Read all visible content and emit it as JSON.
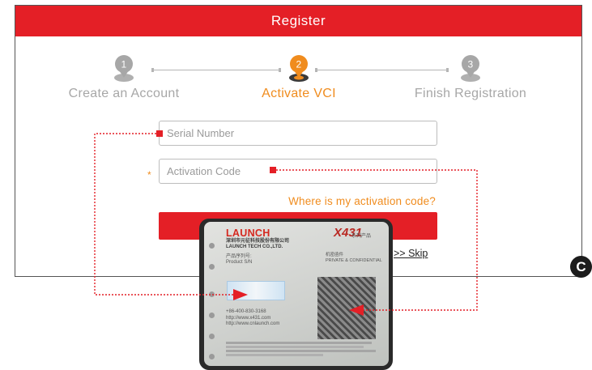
{
  "window": {
    "title": "Register"
  },
  "steps": [
    {
      "number": "1",
      "label": "Create an Account",
      "state": "done",
      "color": "#a7a7a7"
    },
    {
      "number": "2",
      "label": "Activate VCI",
      "state": "active",
      "color": "#f08c1e"
    },
    {
      "number": "3",
      "label": "Finish Registration",
      "state": "pending",
      "color": "#a7a7a7"
    }
  ],
  "form": {
    "serial_placeholder": "Serial Number",
    "activation_placeholder": "Activation Code",
    "required_mark": "*",
    "help_link": "Where is my activation code?",
    "skip_link": ">> Skip"
  },
  "badge": {
    "label": "C"
  },
  "card": {
    "brand": "LAUNCH",
    "company_cn": "深圳市元征科技股份有限公司",
    "company_en": "LAUNCH TECH CO.,LTD.",
    "product": "X431",
    "product_series": "系列产品",
    "serial_label_cn": "产品序列号:",
    "serial_label_en": "Product S/N",
    "confidential_cn": "机密函件",
    "confidential_en": "PRIVATE & CONFIDENTIAL",
    "phone": "+86-400-830-3168",
    "web1": "http://www.x431.com",
    "web2": "http://www.cnlaunch.com"
  },
  "colors": {
    "brand_red": "#e41f26",
    "accent_orange": "#f08c1e",
    "inactive_gray": "#a7a7a7"
  }
}
